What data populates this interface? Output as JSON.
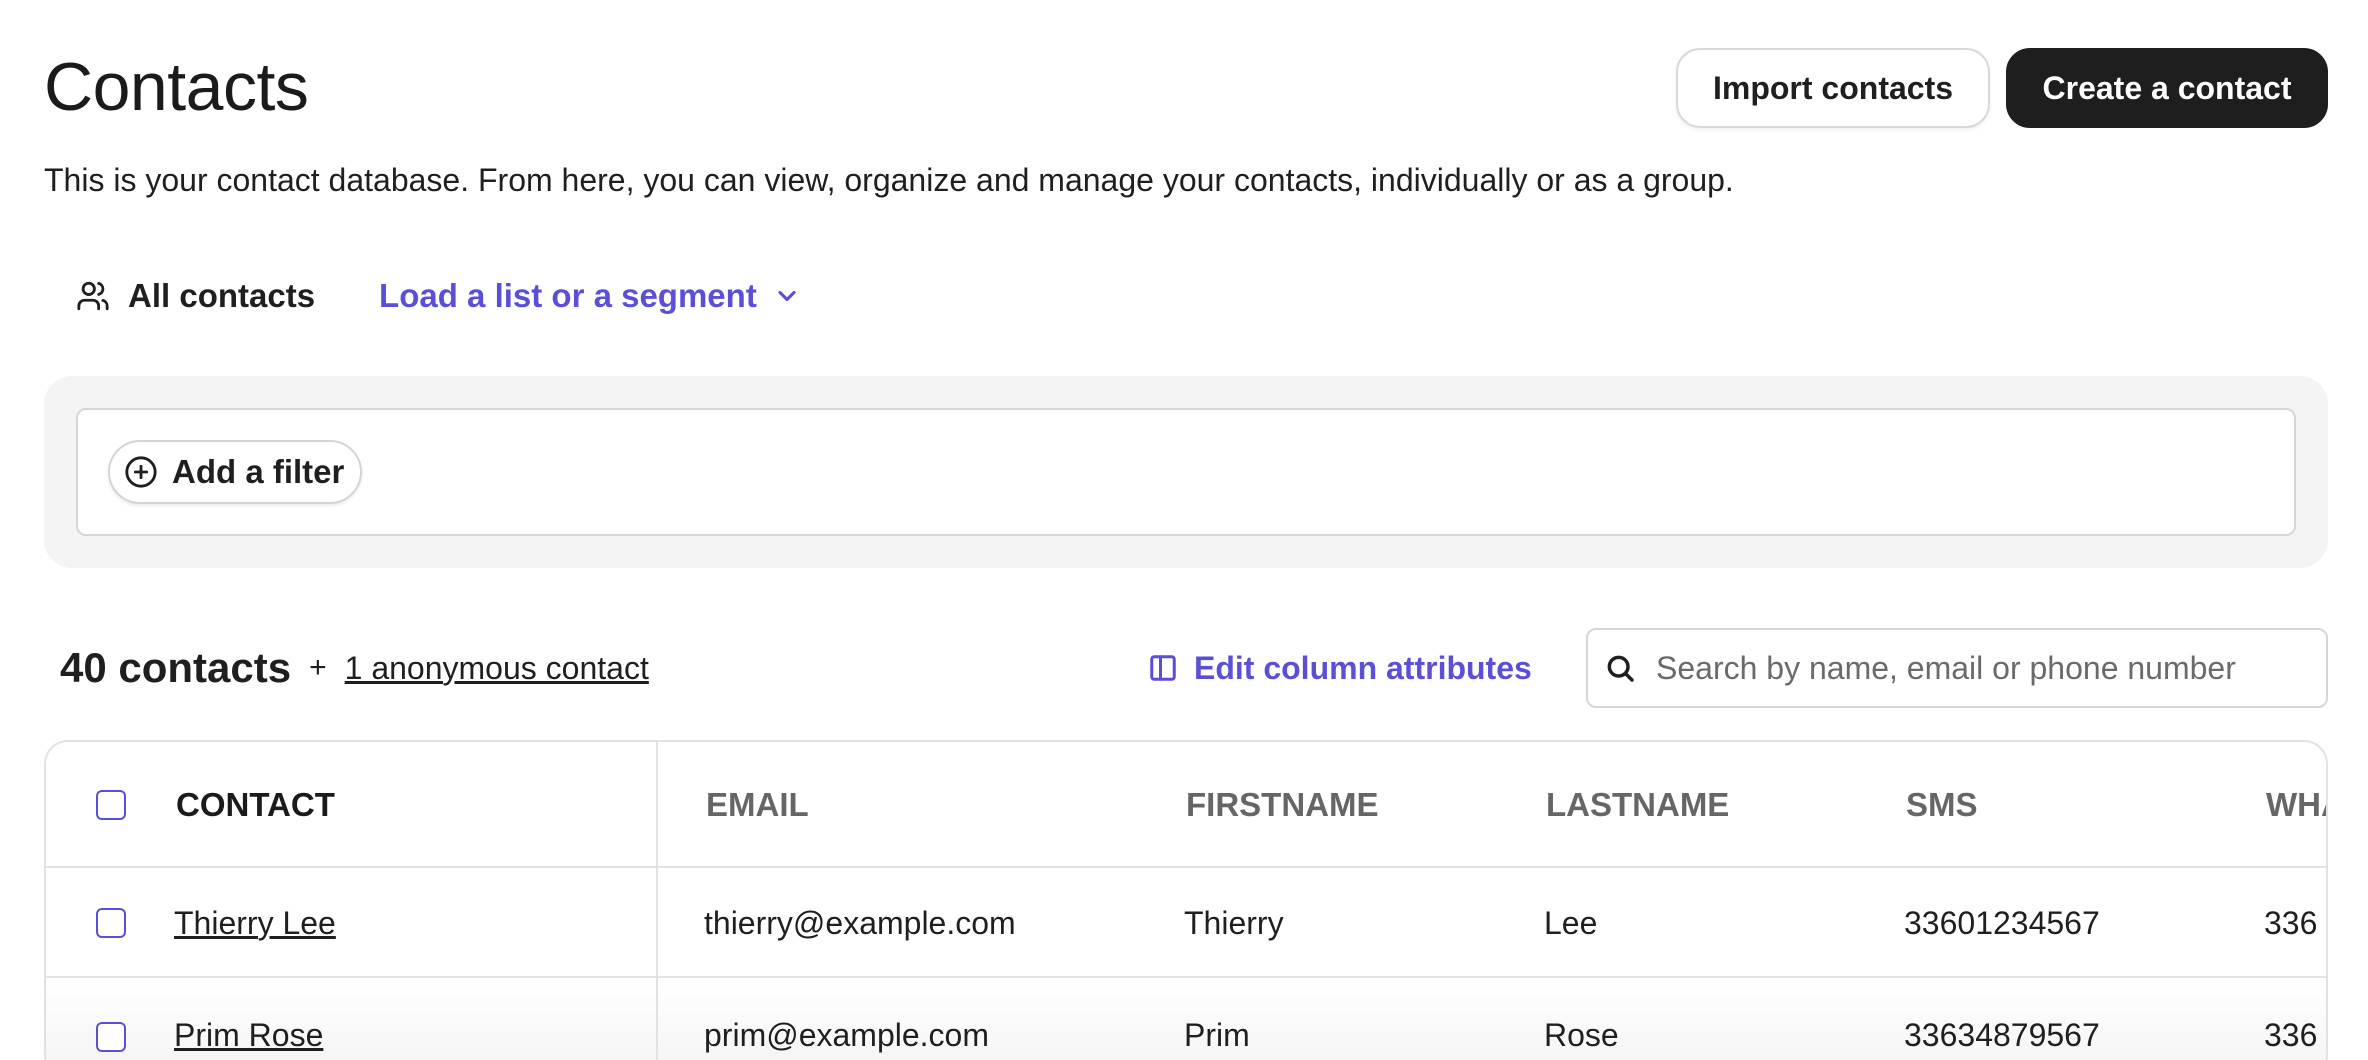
{
  "header": {
    "title": "Contacts",
    "import_label": "Import contacts",
    "create_label": "Create a contact",
    "description": "This is your contact database. From here, you can view, organize and manage your contacts, individually or as a group."
  },
  "views": {
    "all_label": "All contacts",
    "load_label": "Load a list or a segment"
  },
  "filters": {
    "add_label": "Add a filter"
  },
  "summary": {
    "count_label": "40 contacts",
    "plus": "+",
    "anonymous_label": "1 anonymous contact",
    "edit_columns_label": "Edit column attributes"
  },
  "search": {
    "placeholder": "Search by name, email or phone number"
  },
  "table": {
    "columns": [
      "CONTACT",
      "EMAIL",
      "FIRSTNAME",
      "LASTNAME",
      "SMS",
      "WHA"
    ],
    "rows": [
      {
        "name": "Thierry Lee",
        "email": "thierry@example.com",
        "firstname": "Thierry",
        "lastname": "Lee",
        "sms": "33601234567",
        "wha": "336"
      },
      {
        "name": "Prim Rose",
        "email": "prim@example.com",
        "firstname": "Prim",
        "lastname": "Rose",
        "sms": "33634879567",
        "wha": "336"
      }
    ]
  },
  "colors": {
    "accent": "#5b4fd8",
    "primary_button": "#1e1e1e",
    "panel_bg": "#f4f4f4"
  },
  "icons": [
    "users-icon",
    "chevron-down-icon",
    "plus-circle-icon",
    "columns-icon",
    "search-icon"
  ]
}
